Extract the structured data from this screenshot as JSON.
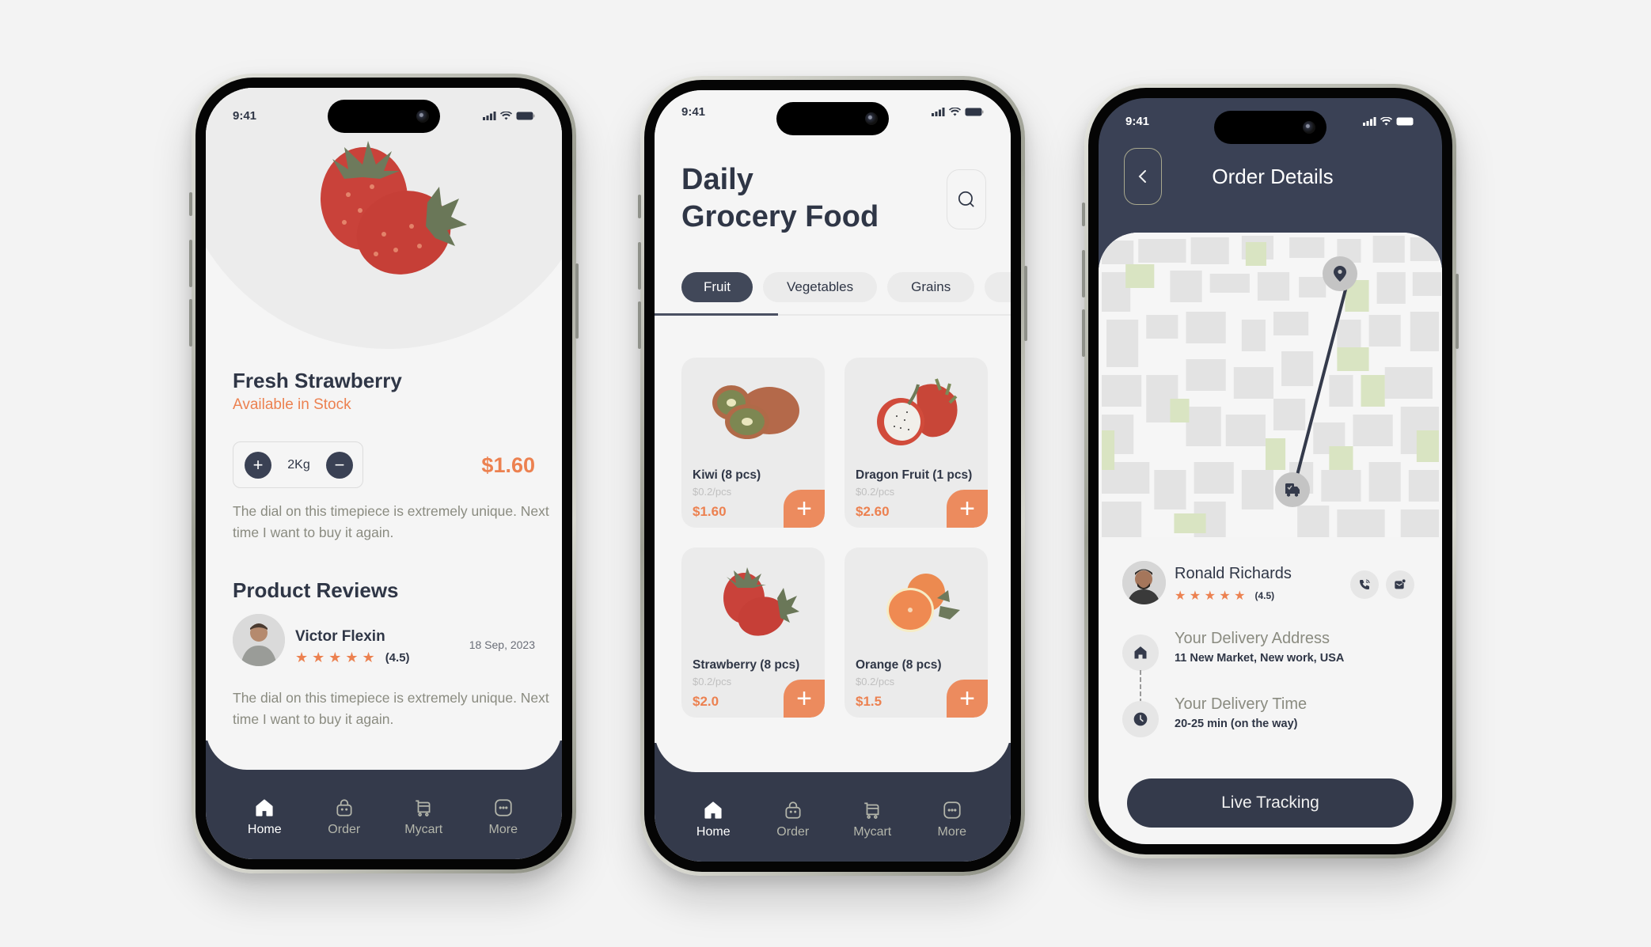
{
  "status_bar": {
    "time": "9:41"
  },
  "product_detail": {
    "title": "Fresh Strawberry",
    "availability": "Available in Stock",
    "quantity": "2Kg",
    "increase_symbol": "+",
    "decrease_symbol": "−",
    "price": "$1.60",
    "description": "The dial on this timepiece is extremely unique. Next time I want to buy it again.",
    "reviews_title": "Product Reviews",
    "review": {
      "name": "Victor Flexin",
      "stars": "★ ★ ★ ★ ★",
      "rating": "(4.5)",
      "date": "18 Sep, 2023",
      "text": "The dial on this timepiece is extremely unique. Next time I want to buy it again."
    }
  },
  "bottom_nav": {
    "items": [
      {
        "label": "Home",
        "icon": "home-icon",
        "active": true
      },
      {
        "label": "Order",
        "icon": "bag-icon",
        "active": false
      },
      {
        "label": "Mycart",
        "icon": "cart-icon",
        "active": false
      },
      {
        "label": "More",
        "icon": "more-icon",
        "active": false
      }
    ]
  },
  "grocery": {
    "title_line1": "Daily",
    "title_line2": "Grocery Food",
    "categories": [
      {
        "label": "Fruit",
        "active": true
      },
      {
        "label": "Vegetables",
        "active": false
      },
      {
        "label": "Grains",
        "active": false
      },
      {
        "label": "",
        "active": false
      }
    ],
    "products": [
      {
        "name": "Kiwi (8 pcs)",
        "unit_price": "$0.2/pcs",
        "price": "$1.60",
        "image": "kiwi"
      },
      {
        "name": "Dragon Fruit (1 pcs)",
        "unit_price": "$0.2/pcs",
        "price": "$2.60",
        "image": "dragon-fruit"
      },
      {
        "name": "Strawberry (8 pcs)",
        "unit_price": "$0.2/pcs",
        "price": "$2.0",
        "image": "strawberry"
      },
      {
        "name": "Orange (8 pcs)",
        "unit_price": "$0.2/pcs",
        "price": "$1.5",
        "image": "orange"
      }
    ],
    "add_symbol": "+"
  },
  "order_details": {
    "title": "Order Details",
    "driver": {
      "name": "Ronald Richards",
      "stars": "★ ★ ★ ★ ★",
      "rating": "(4.5)"
    },
    "address_label": "Your Delivery Address",
    "address_value": "11 New Market, New work, USA",
    "time_label": "Your Delivery Time",
    "time_value": "20-25 min (on the way)",
    "live_tracking_label": "Live Tracking"
  },
  "colors": {
    "accent": "#ec8150",
    "dark": "#343a4b",
    "background": "#f3f3f3"
  }
}
